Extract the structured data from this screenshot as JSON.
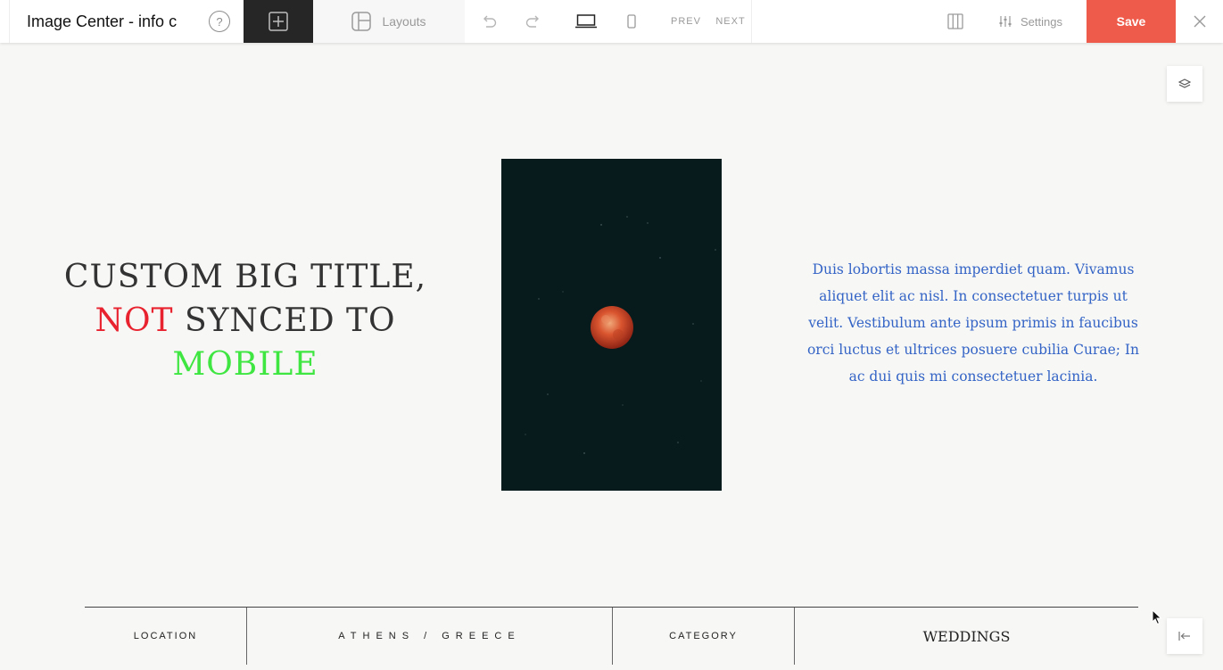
{
  "toolbar": {
    "document_title": "Image Center - info c",
    "help_label": "?",
    "add_icon": "plus-square-icon",
    "layouts_label": "Layouts",
    "prev_label": "PREV",
    "next_label": "NEXT",
    "settings_label": "Settings",
    "save_label": "Save",
    "accent_color": "#ef5b4a"
  },
  "canvas": {
    "title_line1": "CUSTOM BIG TITLE,",
    "title_word_red": "NOT",
    "title_line2_rest": " SYNCED TO",
    "title_word_green": "MOBILE",
    "title_red_color": "#e8232f",
    "title_green_color": "#3fe642",
    "body_text": "Duis lobortis massa imperdiet quam. Vivamus aliquet elit ac nisl. In consectetuer turpis ut velit. Vestibulum ante ipsum primis in faucibus orci luctus et ultrices posuere cubilia Curae; In ac dui quis mi consectetuer lacinia.",
    "body_text_color": "#3464c6"
  },
  "info_bar": {
    "location_label": "LOCATION",
    "location_value": "ATHENS / GREECE",
    "category_label": "CATEGORY",
    "category_value": "WEDDINGS"
  },
  "side_buttons": {
    "layers_icon": "layers-icon",
    "collapse_icon": "collapse-left-icon"
  }
}
